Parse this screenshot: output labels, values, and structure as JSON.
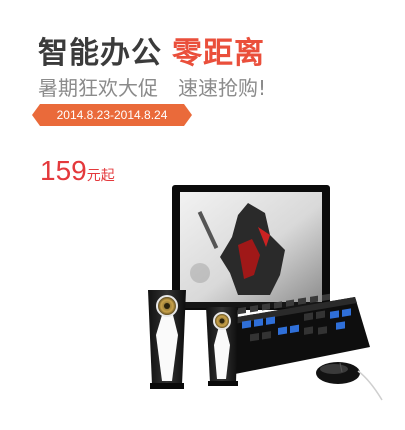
{
  "promo": {
    "title_main": "智能办公",
    "title_accent": "零距离",
    "subtitle": "暑期狂欢大促　速速抢购!",
    "date_range": "2014.8.23-2014.8.24",
    "price": {
      "amount": "159",
      "suffix": "元起"
    }
  },
  "colors": {
    "accent": "#ea4f3b",
    "ribbon": "#ea6a3a",
    "price": "#e4393c"
  },
  "product_image": {
    "icon": "desktop-computer-set-icon"
  }
}
